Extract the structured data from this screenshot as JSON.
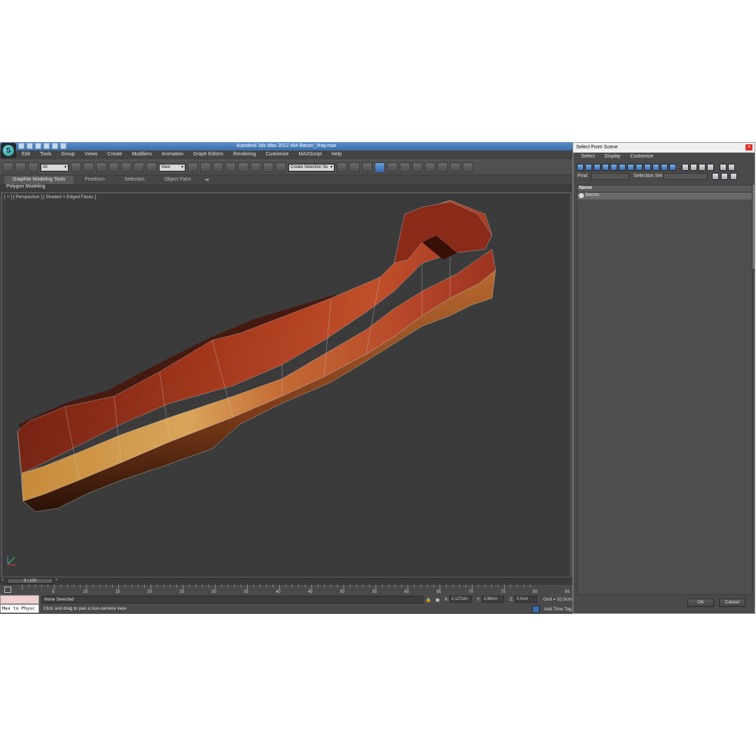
{
  "app": {
    "title": "Autodesk 3ds Max  2012 x64     Bacon_Vray.max",
    "logo_letter": "S",
    "menu": [
      "Edit",
      "Tools",
      "Group",
      "Views",
      "Create",
      "Modifiers",
      "Animation",
      "Graph Editors",
      "Rendering",
      "Customize",
      "MAXScript",
      "Help"
    ]
  },
  "toolbar": {
    "filter_value": "All",
    "ref_coord_value": "View",
    "selection_set_placeholder": "Create Selection Se"
  },
  "ribbon": {
    "tabs": [
      "Graphite Modeling Tools",
      "Freeform",
      "Selection",
      "Object Paint"
    ],
    "panel_label": "Polygon Modeling"
  },
  "viewport": {
    "label": "[ + ] [ Perspective ] [ Shaded + Edged Faces ]"
  },
  "timeline": {
    "frame_readout": "0 / 100",
    "prev_arrow": "<",
    "next_arrow": ">",
    "ticks": [
      "5",
      "10",
      "15",
      "20",
      "25",
      "30",
      "35",
      "40",
      "45",
      "50",
      "55",
      "60",
      "65",
      "70",
      "75",
      "80",
      "85"
    ]
  },
  "status": {
    "script_text": "Max to Physc",
    "selection": "None Selected",
    "prompt": "Click and drag to pan a non-camera view",
    "x_label": "X:",
    "x_value": "2,127cm",
    "y_label": "Y:",
    "y_value": "2,96cm",
    "z_label": "Z:",
    "z_value": "0,0cm",
    "grid": "Grid = 10,0cm",
    "add_time_tag": "Add Time Tag"
  },
  "dialog": {
    "title": "Select From Scene",
    "close_glyph": "x",
    "menu": [
      "Select",
      "Display",
      "Customize"
    ],
    "find_label": "Find:",
    "selection_set_label": "Selection Set:",
    "list_header": "Name",
    "items": [
      "bacon"
    ],
    "ok_label": "OK",
    "cancel_label": "Cancel"
  },
  "colors": {
    "accent": "#3a6eaa",
    "viewport_bg": "#3b3b3b",
    "dialog_bg": "#4a4a4a"
  }
}
